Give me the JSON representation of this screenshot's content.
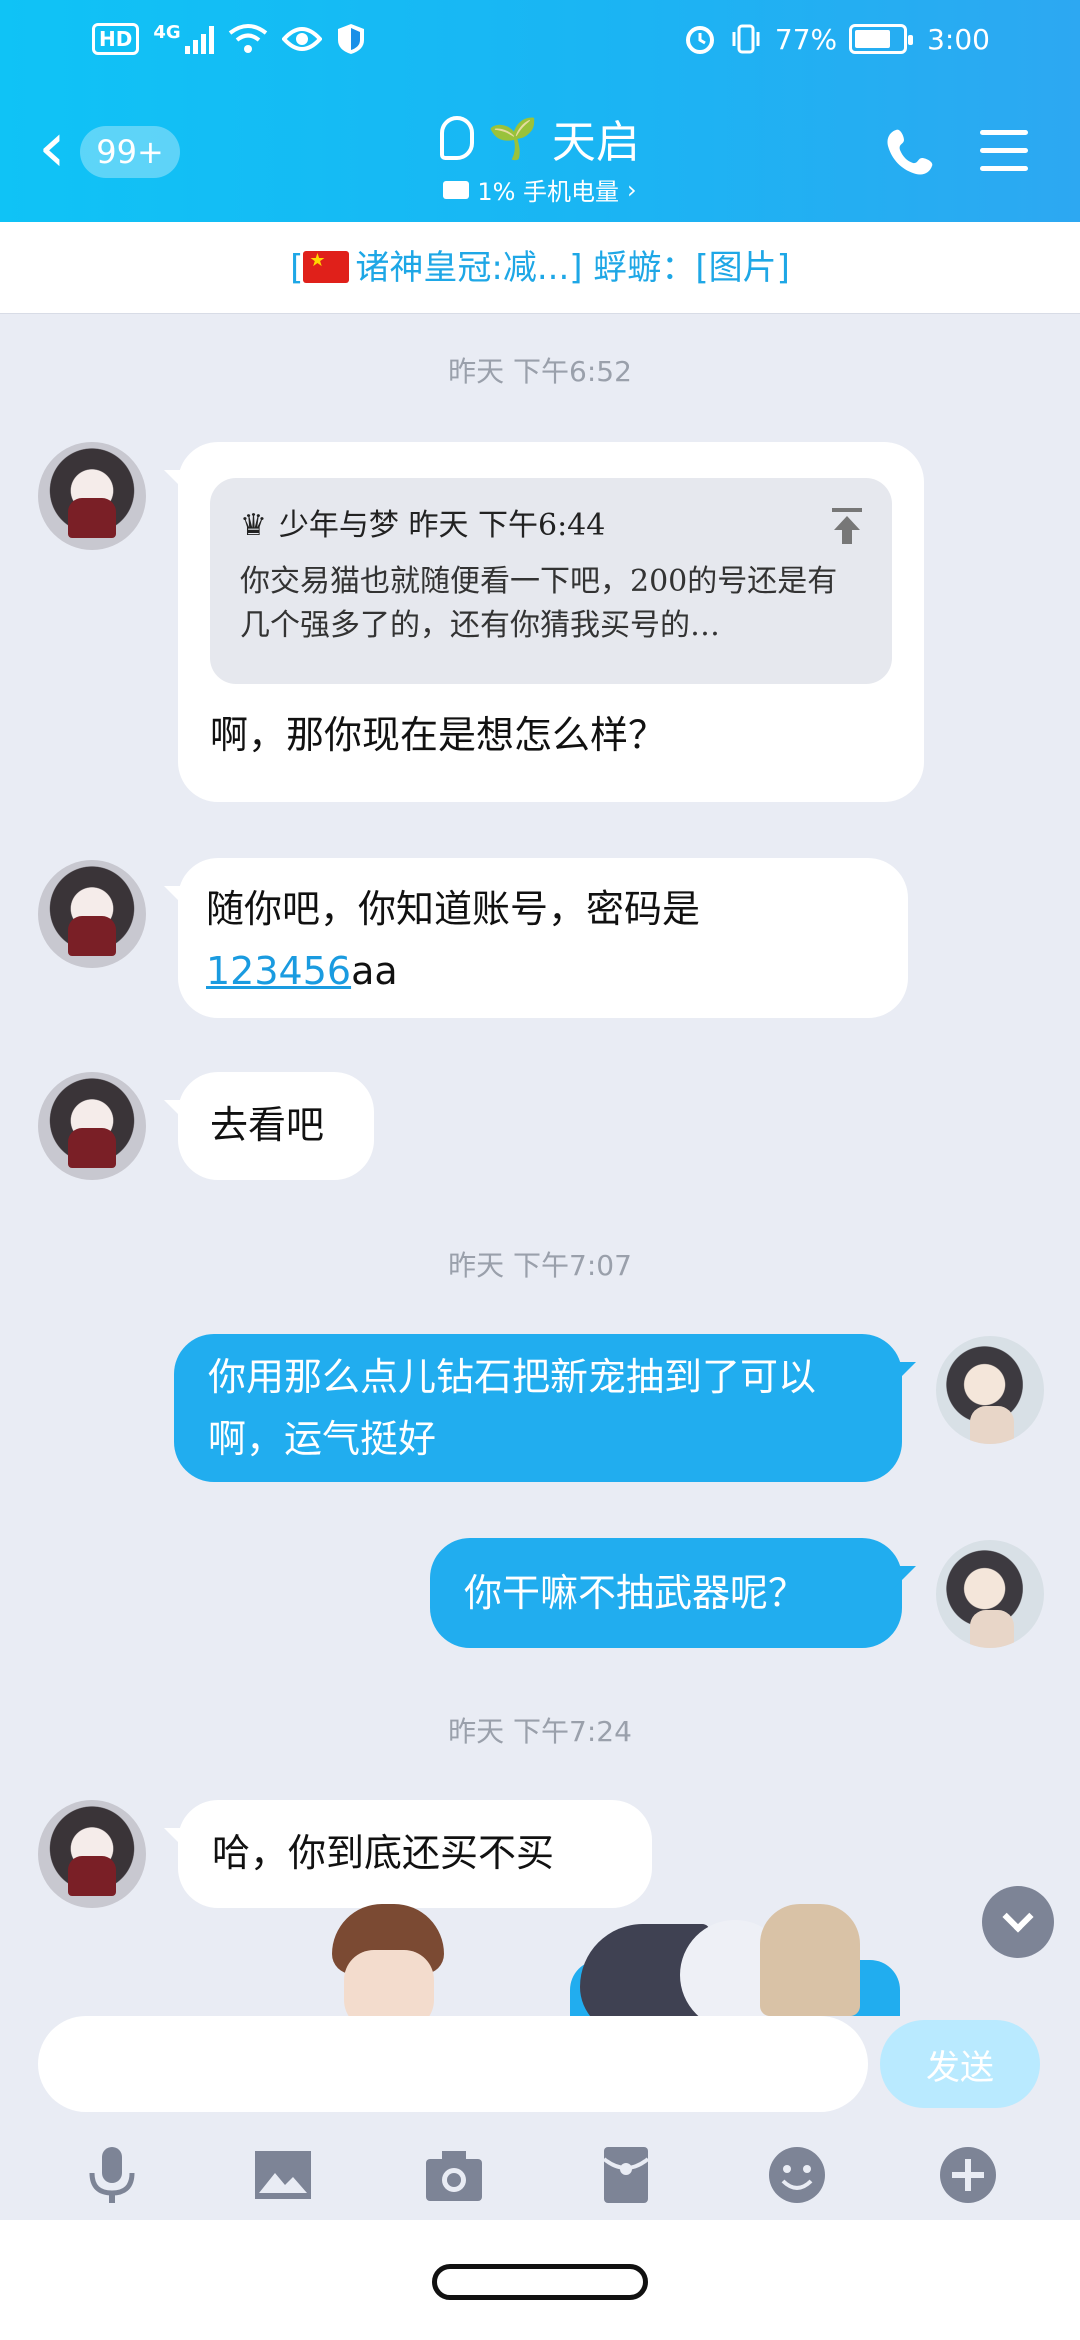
{
  "status_bar": {
    "hd": "HD",
    "network": "4G",
    "battery_percent": "77%",
    "battery_level": 0.77,
    "time": "3:00"
  },
  "header": {
    "back_icon": "chevron-left-icon",
    "unread_count": "99+",
    "title": "天启",
    "subtitle": "1% 手机电量",
    "phone_icon": "phone-icon",
    "menu_icon": "menu-icon"
  },
  "banner": {
    "text": "诸神皇冠:减...] 蜉蝣：[图片]",
    "prefix": "["
  },
  "messages": [
    {
      "type": "time",
      "text": "昨天 下午6:52"
    },
    {
      "type": "incoming",
      "quote": {
        "author_time": "少年与梦 昨天 下午6:44",
        "text": "你交易猫也就随便看一下吧，200的号还是有几个强多了的，还有你猜我买号的…"
      },
      "text": "啊，那你现在是想怎么样？"
    },
    {
      "type": "incoming",
      "text_before": "随你吧，你知道账号，密码是",
      "link": "123456",
      "text_after": "aa"
    },
    {
      "type": "incoming",
      "text": "去看吧"
    },
    {
      "type": "time",
      "text": "昨天 下午7:07"
    },
    {
      "type": "outgoing",
      "text": "你用那么点儿钻石把新宠抽到了可以啊，运气挺好"
    },
    {
      "type": "outgoing",
      "text": "你干嘛不抽武器呢？"
    },
    {
      "type": "time",
      "text": "昨天 下午7:24"
    },
    {
      "type": "incoming",
      "text": "哈，你到底还买不买"
    }
  ],
  "input": {
    "placeholder": "",
    "send_label": "发送"
  },
  "toolbar": [
    "microphone-icon",
    "image-icon",
    "camera-icon",
    "red-packet-icon",
    "emoji-icon",
    "plus-icon"
  ],
  "colors": {
    "header_start": "#0fc3f6",
    "header_end": "#2da8f2",
    "outgoing_bubble": "#21adef",
    "background": "#e9ecf4",
    "link": "#1a9be0"
  }
}
